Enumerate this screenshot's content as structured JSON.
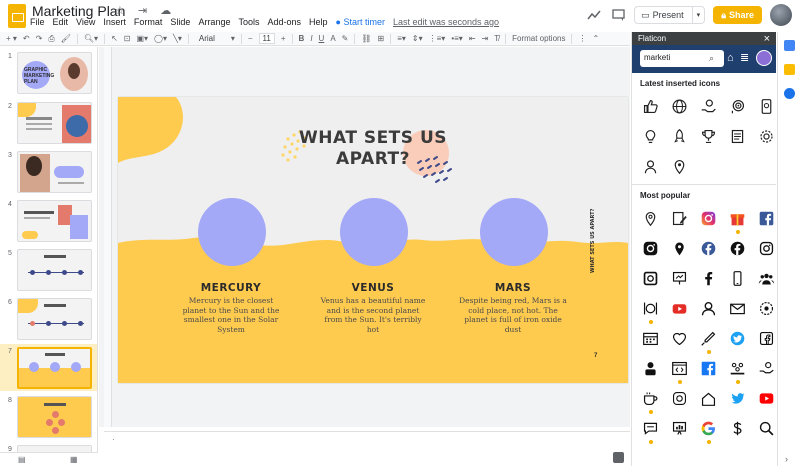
{
  "doc": {
    "title": "Marketing Plan",
    "title_icons": "☆ ⇥ ☁"
  },
  "menu": [
    "File",
    "Edit",
    "View",
    "Insert",
    "Format",
    "Slide",
    "Arrange",
    "Tools",
    "Add-ons",
    "Help"
  ],
  "menu_extra": {
    "timer": "● Start timer",
    "last_edit": "Last edit was seconds ago"
  },
  "header": {
    "present_label": "Present",
    "share_label": "Share"
  },
  "toolbar": {
    "font": "Arial",
    "font_size": "11",
    "format_options": "Format options"
  },
  "filmstrip": {
    "numbers": [
      "1",
      "2",
      "3",
      "4",
      "5",
      "6",
      "7",
      "8",
      "9"
    ],
    "slide1_title": "GRAPHIC MARKETING PLAN"
  },
  "slide": {
    "title": "WHAT SETS US APART?",
    "vertical_text": "WHAT SETS US APART?",
    "number": "7",
    "colors": {
      "yellow": "#ffcb4f",
      "purple": "#a3a8f7",
      "navy": "#3f4a8a",
      "peach": "#f9cdb9"
    },
    "planets": [
      {
        "name": "MERCURY",
        "desc": "Mercury is the closest planet to the Sun and the smallest one in the Solar System"
      },
      {
        "name": "VENUS",
        "desc": "Venus has a beautiful name and is the second planet from the Sun. It's terribly hot"
      },
      {
        "name": "MARS",
        "desc": "Despite being red, Mars is a cold place, not hot. The planet is full of iron oxide dust"
      }
    ]
  },
  "flaticon": {
    "header": "Flaticon",
    "close": "×",
    "search_value": "marketi",
    "latest_label": "Latest inserted icons",
    "popular_label": "Most popular",
    "latest_icons": [
      "thumbs-up-icon",
      "globe-icon",
      "money-hand-icon",
      "target-head-icon",
      "mobile-money-icon",
      "lightbulb-dollar-icon",
      "rocket-icon",
      "trophy-icon",
      "newspaper-icon",
      "gear-icon",
      "support-agent-icon",
      "location-pin-icon"
    ],
    "popular_icons": [
      "location-pin-outline-icon",
      "edit-form-icon",
      "instagram-icon",
      "gift-icon",
      "facebook-icon",
      "instagram-black-icon",
      "location-pin-solid-icon",
      "facebook-circle-icon",
      "facebook-black-icon",
      "instagram-outline-icon",
      "instagram-square-icon",
      "presentation-icon",
      "facebook-f-icon",
      "smartphone-icon",
      "group-icon",
      "restaurant-icon",
      "youtube-icon",
      "user-icon",
      "mail-icon",
      "settings-badge-icon",
      "calendar-icon",
      "heart-icon",
      "syringe-icon",
      "twitter-icon",
      "facebook-square-outline-icon",
      "person-icon",
      "code-window-icon",
      "facebook-blue-icon",
      "team-icon",
      "hand-coins-icon",
      "coffee-icon",
      "instagram-thin-icon",
      "home-icon",
      "twitter-blue-icon",
      "youtube-red-icon",
      "chat-icon",
      "presentation-chart-icon",
      "google-icon",
      "money-dollar-icon",
      "search-icon"
    ]
  }
}
